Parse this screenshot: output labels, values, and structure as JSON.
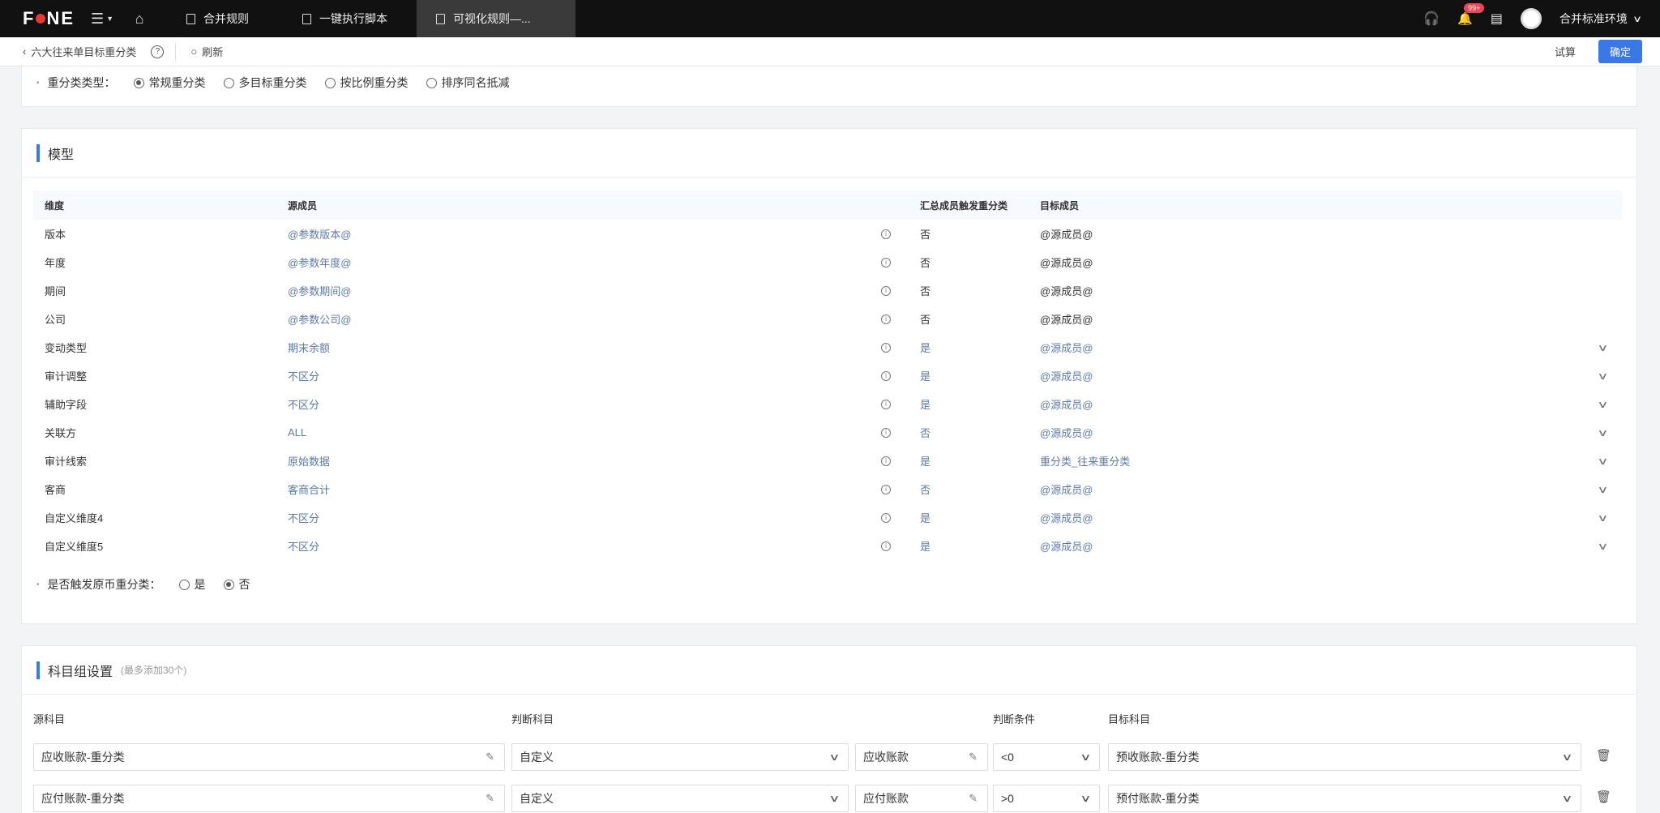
{
  "topbar": {
    "logo": "FONE",
    "tabs": [
      {
        "label": "合并规则",
        "active": false
      },
      {
        "label": "一键执行脚本",
        "active": false
      },
      {
        "label": "可视化规则—...",
        "active": true
      }
    ],
    "badge": "99+",
    "env_label": "合并标准环境"
  },
  "subbar": {
    "breadcrumb": "六大往来单目标重分类",
    "refresh": "刷新",
    "trial": "试算",
    "confirm": "确定"
  },
  "reclass": {
    "label": "重分类类型：",
    "options": [
      {
        "label": "常规重分类",
        "selected": true
      },
      {
        "label": "多目标重分类",
        "selected": false
      },
      {
        "label": "按比例重分类",
        "selected": false
      },
      {
        "label": "排序同名抵减",
        "selected": false
      }
    ]
  },
  "model": {
    "title": "模型",
    "columns": [
      "维度",
      "源成员",
      "汇总成员触发重分类",
      "目标成员"
    ],
    "rows": [
      {
        "dim": "版本",
        "src": "@参数版本@",
        "trigger": "否",
        "target": "@源成员@",
        "editable": false
      },
      {
        "dim": "年度",
        "src": "@参数年度@",
        "trigger": "否",
        "target": "@源成员@",
        "editable": false
      },
      {
        "dim": "期间",
        "src": "@参数期间@",
        "trigger": "否",
        "target": "@源成员@",
        "editable": false
      },
      {
        "dim": "公司",
        "src": "@参数公司@",
        "trigger": "否",
        "target": "@源成员@",
        "editable": false
      },
      {
        "dim": "变动类型",
        "src": "期末余额",
        "trigger": "是",
        "target": "@源成员@",
        "editable": true
      },
      {
        "dim": "审计调整",
        "src": "不区分",
        "trigger": "是",
        "target": "@源成员@",
        "editable": true
      },
      {
        "dim": "辅助字段",
        "src": "不区分",
        "trigger": "是",
        "target": "@源成员@",
        "editable": true
      },
      {
        "dim": "关联方",
        "src": "ALL",
        "trigger": "否",
        "target": "@源成员@",
        "editable": true
      },
      {
        "dim": "审计线索",
        "src": "原始数据",
        "trigger": "是",
        "target": "重分类_往来重分类",
        "editable": true
      },
      {
        "dim": "客商",
        "src": "客商合计",
        "trigger": "否",
        "target": "@源成员@",
        "editable": true
      },
      {
        "dim": "自定义维度4",
        "src": "不区分",
        "trigger": "是",
        "target": "@源成员@",
        "editable": true
      },
      {
        "dim": "自定义维度5",
        "src": "不区分",
        "trigger": "是",
        "target": "@源成员@",
        "editable": true
      }
    ],
    "currency_label": "是否触发原币重分类：",
    "currency_options": [
      {
        "label": "是",
        "selected": false
      },
      {
        "label": "否",
        "selected": true
      }
    ]
  },
  "subjects": {
    "title": "科目组设置",
    "hint": "(最多添加30个)",
    "columns": [
      "源科目",
      "判断科目",
      "判断条件",
      "目标科目"
    ],
    "rows": [
      {
        "src": "应收账款-重分类",
        "judge_type": "自定义",
        "judge": "应收账款",
        "cond": "<0",
        "target": "预收账款-重分类"
      },
      {
        "src": "应付账款-重分类",
        "judge_type": "自定义",
        "judge": "应付账款",
        "cond": ">0",
        "target": "预付账款-重分类"
      }
    ]
  },
  "icons": {
    "menu": "menu-icon",
    "home": "home-icon",
    "headset": "headset-icon",
    "bell": "bell-icon",
    "layout": "layout-icon",
    "edit": "edit-icon",
    "trash": "trash-icon",
    "info": "info-icon",
    "chevron": "chevron-down-icon"
  },
  "colors": {
    "accent": "#3b78e7",
    "topbar": "#111111",
    "badge": "#e84855",
    "link": "#5b7aa6"
  }
}
